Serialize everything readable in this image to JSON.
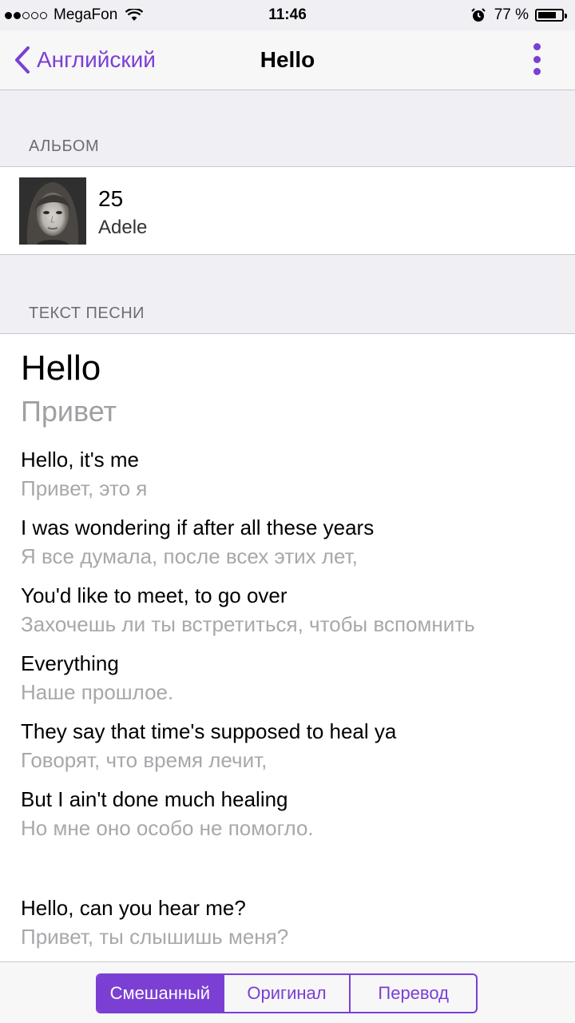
{
  "status_bar": {
    "carrier": "MegaFon",
    "time": "11:46",
    "battery": "77 %",
    "battery_level": 0.77,
    "signal_bars": 2,
    "icons": [
      "signal-dots-icon",
      "wifi-icon",
      "alarm-icon",
      "battery-icon"
    ]
  },
  "nav": {
    "back_label": "Английский",
    "title": "Hello",
    "more_icon": "more-vertical-icon",
    "accent_color": "#7b3fd4"
  },
  "album_section": {
    "header": "АЛЬБОМ",
    "album_title": "25",
    "artist": "Adele"
  },
  "lyrics_section": {
    "header": "ТЕКСТ ПЕСНИ",
    "title": "Hello",
    "title_translation": "Привет",
    "lines": [
      {
        "original": "Hello, it's me",
        "translation": "Привет, это я"
      },
      {
        "original": "I was wondering if after all these years",
        "translation": "Я все думала, после всех этих лет,"
      },
      {
        "original": "You'd like to meet, to go over",
        "translation": "Захочешь ли ты встретиться, чтобы вспомнить"
      },
      {
        "original": "Everything",
        "translation": "Наше прошлое."
      },
      {
        "original": "They say that time's supposed to heal ya",
        "translation": "Говорят, что время лечит,"
      },
      {
        "original": "But I ain't done much healing",
        "translation": "Но мне оно особо не помогло."
      },
      {
        "original": "Hello, can you hear me?",
        "translation": "Привет, ты слышишь меня?"
      }
    ]
  },
  "mode_selector": {
    "options": [
      "Смешанный",
      "Оригинал",
      "Перевод"
    ],
    "selected": "Смешанный"
  }
}
